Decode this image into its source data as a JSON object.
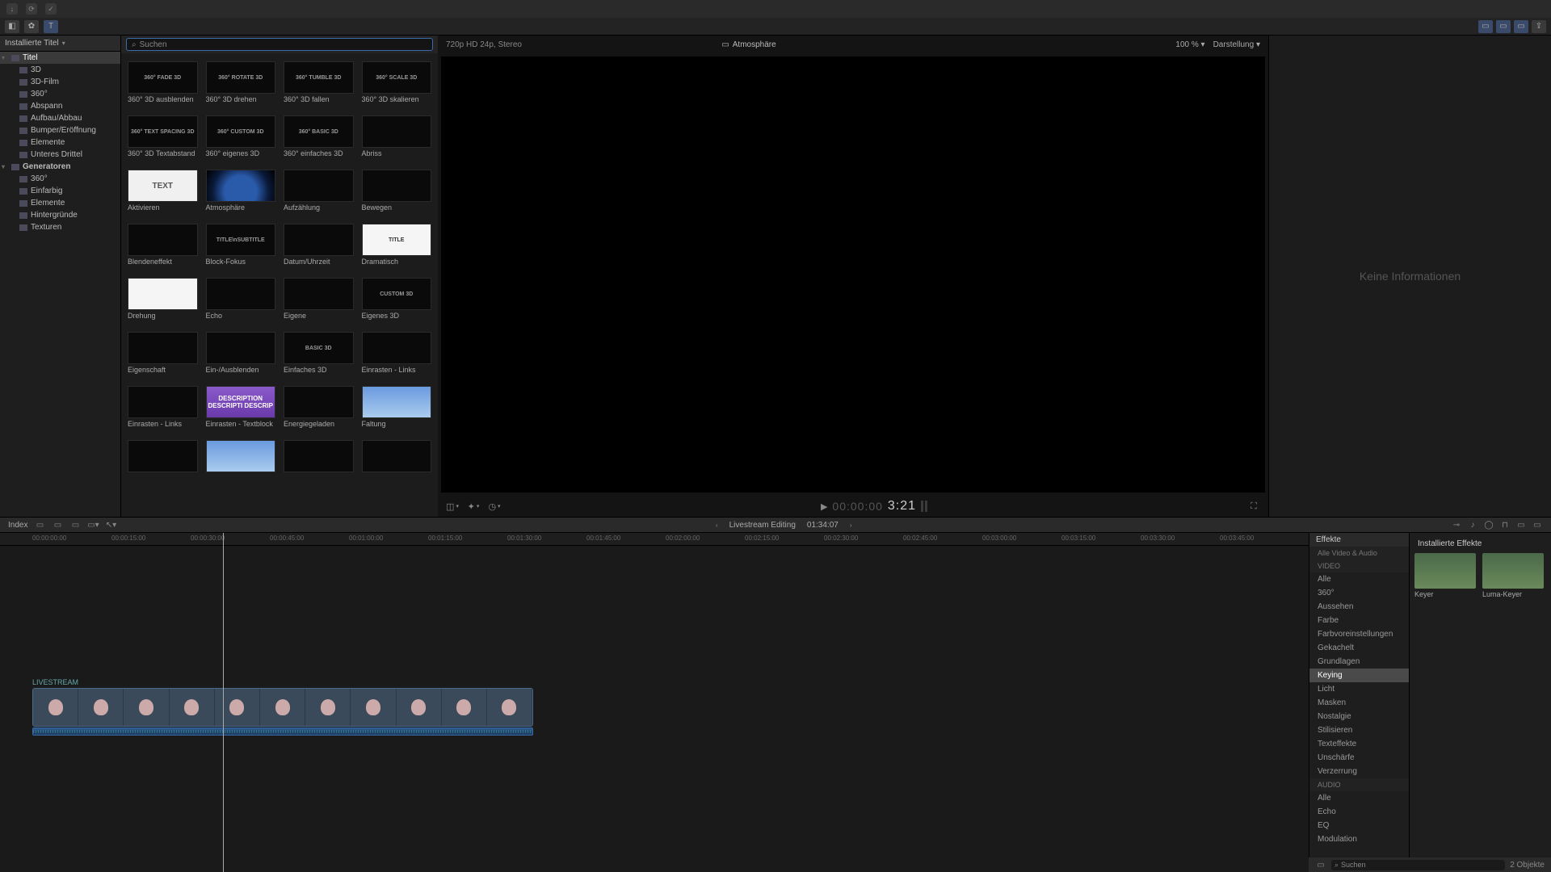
{
  "titlebar": {
    "icons": [
      "↓",
      "⟳",
      "✓"
    ]
  },
  "toolbar": {
    "right_icons": [
      "▭",
      "▭",
      "▭",
      "▭"
    ]
  },
  "sidebar": {
    "header": "Installierte Titel",
    "items": [
      {
        "label": "Titel",
        "sel": true,
        "parent": true,
        "expanded": true
      },
      {
        "label": "3D"
      },
      {
        "label": "3D-Film"
      },
      {
        "label": "360°"
      },
      {
        "label": "Abspann"
      },
      {
        "label": "Aufbau/Abbau"
      },
      {
        "label": "Bumper/Eröffnung"
      },
      {
        "label": "Elemente"
      },
      {
        "label": "Unteres Drittel"
      },
      {
        "label": "Generatoren",
        "bold": true,
        "parent": true,
        "expanded": true
      },
      {
        "label": "360°"
      },
      {
        "label": "Einfarbig"
      },
      {
        "label": "Elemente"
      },
      {
        "label": "Hintergründe"
      },
      {
        "label": "Texturen"
      }
    ]
  },
  "browser": {
    "search_placeholder": "Suchen",
    "tiles": [
      {
        "label": "360° 3D ausblenden",
        "thumb": "360° FADE 3D"
      },
      {
        "label": "360° 3D drehen",
        "thumb": "360° ROTATE 3D"
      },
      {
        "label": "360° 3D fallen",
        "thumb": "360° TUMBLE 3D"
      },
      {
        "label": "360° 3D skalieren",
        "thumb": "360° SCALE 3D"
      },
      {
        "label": "360° 3D Textabstand",
        "thumb": "360° TEXT SPACING 3D"
      },
      {
        "label": "360° eigenes 3D",
        "thumb": "360° CUSTOM 3D"
      },
      {
        "label": "360° einfaches 3D",
        "thumb": "360° BASIC 3D"
      },
      {
        "label": "Abriss",
        "thumb": "",
        "cls": ""
      },
      {
        "label": "Aktivieren",
        "thumb": "TEXT",
        "cls": "text"
      },
      {
        "label": "Atmosphäre",
        "thumb": "",
        "cls": "earth"
      },
      {
        "label": "Aufzählung",
        "thumb": ""
      },
      {
        "label": "Bewegen",
        "thumb": ""
      },
      {
        "label": "Blendeneffekt",
        "thumb": ""
      },
      {
        "label": "Block-Fokus",
        "thumb": "TITLE\\nSUBTITLE"
      },
      {
        "label": "Datum/Uhrzeit",
        "thumb": ""
      },
      {
        "label": "Dramatisch",
        "thumb": "TITLE",
        "cls": "white"
      },
      {
        "label": "Drehung",
        "thumb": "",
        "cls": "white"
      },
      {
        "label": "Echo",
        "thumb": ""
      },
      {
        "label": "Eigene",
        "thumb": ""
      },
      {
        "label": "Eigenes 3D",
        "thumb": "CUSTOM 3D"
      },
      {
        "label": "Eigenschaft",
        "thumb": ""
      },
      {
        "label": "Ein-/Ausblenden",
        "thumb": ""
      },
      {
        "label": "Einfaches 3D",
        "thumb": "BASIC 3D"
      },
      {
        "label": "Einrasten - Links",
        "thumb": ""
      },
      {
        "label": "Einrasten - Links",
        "thumb": ""
      },
      {
        "label": "Einrasten - Textblock",
        "thumb": "DESCRIPTION DESCRIPTI DESCRIP",
        "cls": "purple"
      },
      {
        "label": "Energiegeladen",
        "thumb": ""
      },
      {
        "label": "Faltung",
        "thumb": "",
        "cls": "sky"
      },
      {
        "label": "",
        "thumb": ""
      },
      {
        "label": "",
        "thumb": "",
        "cls": "sky"
      },
      {
        "label": "",
        "thumb": ""
      },
      {
        "label": "",
        "thumb": ""
      }
    ]
  },
  "viewer": {
    "format": "720p HD 24p, Stereo",
    "title": "Atmosphäre",
    "zoom": "100 %",
    "view_menu": "Darstellung",
    "timecode_prefix": "▶ 00:00:00",
    "timecode": "3:21"
  },
  "inspector": {
    "empty": "Keine Informationen"
  },
  "timeline_bar": {
    "index": "Index",
    "project": "Livestream Editing",
    "duration": "01:34:07"
  },
  "ruler": [
    "00:00:00:00",
    "00:00:15:00",
    "00:00:30:00",
    "00:00:45:00",
    "00:01:00:00",
    "00:01:15:00",
    "00:01:30:00",
    "00:01:45:00",
    "00:02:00:00",
    "00:02:15:00",
    "00:02:30:00",
    "00:02:45:00",
    "00:03:00:00",
    "00:03:15:00",
    "00:03:30:00",
    "00:03:45:00"
  ],
  "clip": {
    "name": "LIVESTREAM"
  },
  "effects": {
    "header": "Effekte",
    "installed": "Installierte Effekte",
    "cats": [
      {
        "label": "Alle Video & Audio",
        "head": true
      },
      {
        "label": "VIDEO",
        "head": true
      },
      {
        "label": "Alle"
      },
      {
        "label": "360°"
      },
      {
        "label": "Aussehen"
      },
      {
        "label": "Farbe"
      },
      {
        "label": "Farbvoreinstellungen"
      },
      {
        "label": "Gekachelt"
      },
      {
        "label": "Grundlagen"
      },
      {
        "label": "Keying",
        "sel": true
      },
      {
        "label": "Licht"
      },
      {
        "label": "Masken"
      },
      {
        "label": "Nostalgie"
      },
      {
        "label": "Stilisieren"
      },
      {
        "label": "Texteffekte"
      },
      {
        "label": "Unschärfe"
      },
      {
        "label": "Verzerrung"
      },
      {
        "label": "AUDIO",
        "head": true
      },
      {
        "label": "Alle"
      },
      {
        "label": "Echo"
      },
      {
        "label": "EQ"
      },
      {
        "label": "Modulation"
      }
    ],
    "tiles": [
      {
        "label": "Keyer"
      },
      {
        "label": "Luma-Keyer"
      }
    ],
    "foot_search": "Suchen",
    "foot_count": "2 Objekte"
  }
}
